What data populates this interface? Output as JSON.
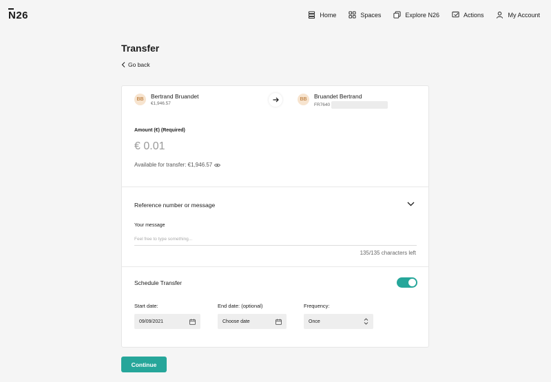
{
  "brand": {
    "logo": "N26",
    "accent": "#26a69a"
  },
  "nav": {
    "items": [
      {
        "label": "Home",
        "icon": "home-icon"
      },
      {
        "label": "Spaces",
        "icon": "spaces-icon"
      },
      {
        "label": "Explore N26",
        "icon": "explore-icon"
      },
      {
        "label": "Actions",
        "icon": "actions-icon"
      },
      {
        "label": "My Account",
        "icon": "account-icon"
      }
    ]
  },
  "page": {
    "title": "Transfer",
    "back_label": "Go back"
  },
  "sender": {
    "initials": "BB",
    "name": "Bertrand Bruandet",
    "balance": "€1,946.57"
  },
  "recipient": {
    "initials": "BB",
    "name": "Bruandet Bertrand",
    "iban_prefix": "FR7640"
  },
  "amount": {
    "label": "Amount (€) (Required)",
    "value": "€ 0.01",
    "available": "Available for transfer: €1,946.57"
  },
  "reference": {
    "header": "Reference number or message",
    "message_label": "Your message",
    "placeholder": "Feel free to type something...",
    "char_count": "135/135 characters left"
  },
  "schedule": {
    "label": "Schedule Transfer",
    "enabled": true,
    "start_label": "Start date:",
    "start_value": "09/09/2021",
    "end_label": "End date: (optional)",
    "end_value": "Choose date",
    "freq_label": "Frequency:",
    "freq_value": "Once"
  },
  "actions": {
    "continue_label": "Continue"
  }
}
